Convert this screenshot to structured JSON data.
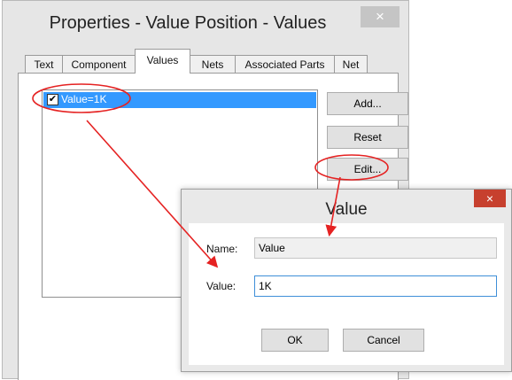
{
  "properties_dialog": {
    "title": "Properties - Value Position - Values",
    "close_glyph": "×",
    "tabs": [
      {
        "label": "Text"
      },
      {
        "label": "Component"
      },
      {
        "label": "Values",
        "active": true
      },
      {
        "label": "Nets"
      },
      {
        "label": "Associated Parts"
      },
      {
        "label": "Net"
      }
    ],
    "list_items": [
      {
        "label": "Value=1K",
        "checked": true,
        "check_glyph": "✔"
      }
    ],
    "buttons": {
      "add": "Add...",
      "reset": "Reset",
      "edit": "Edit..."
    }
  },
  "value_dialog": {
    "title": "Value",
    "close_glyph": "×",
    "name_label": "Name:",
    "name_value": "Value",
    "value_label": "Value:",
    "value_value": "1K",
    "ok_label": "OK",
    "cancel_label": "Cancel"
  },
  "colors": {
    "selection": "#3399ff",
    "annotation": "#e52222",
    "close_active": "#c7402e",
    "focus_border": "#3f8fd8"
  },
  "icons": [
    "check-icon",
    "close-icon"
  ]
}
